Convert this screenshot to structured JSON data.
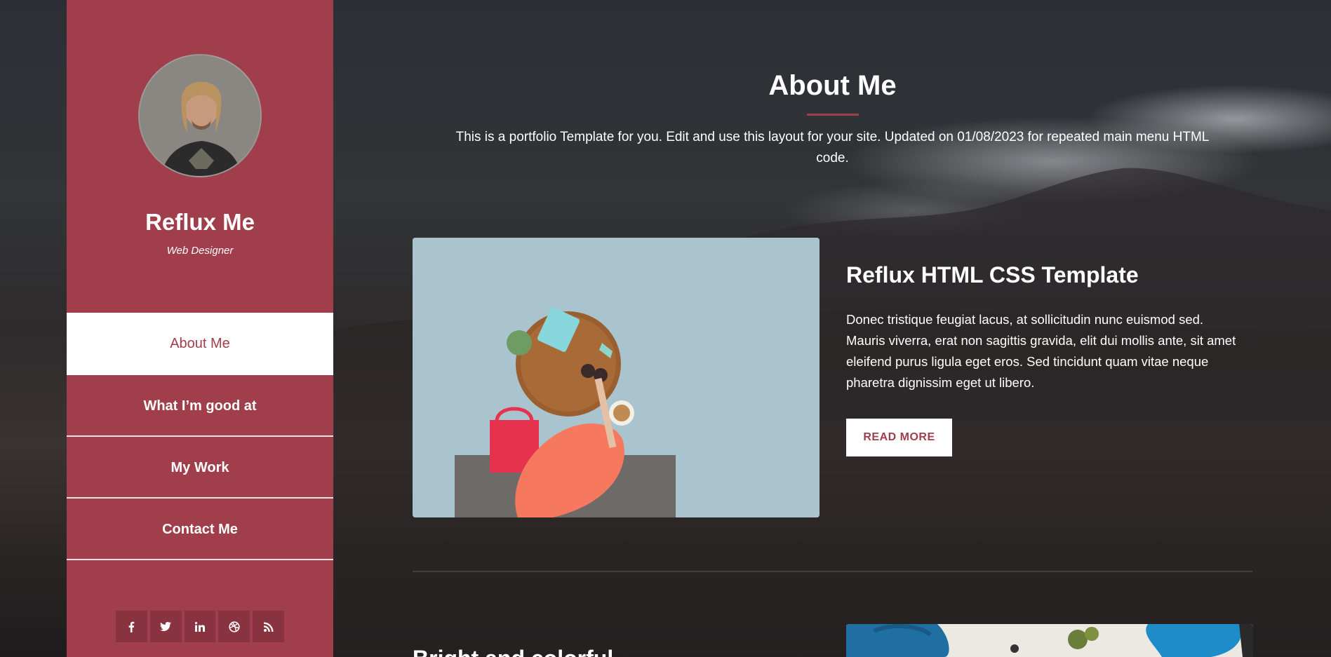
{
  "sidebar": {
    "profile_name": "Reflux Me",
    "profile_role": "Web Designer",
    "nav": [
      {
        "label": "About Me",
        "active": true
      },
      {
        "label": "What I’m good at",
        "active": false
      },
      {
        "label": "My Work",
        "active": false
      },
      {
        "label": "Contact Me",
        "active": false
      }
    ],
    "social": [
      "facebook-icon",
      "twitter-icon",
      "linkedin-icon",
      "dribbble-icon",
      "rss-icon"
    ]
  },
  "main": {
    "section_title": "About Me",
    "intro": "This is a portfolio Template for you. Edit and use this layout for your site. Updated on 01/08/2023 for repeated main menu HTML code.",
    "feature": {
      "title": "Reflux HTML CSS Template",
      "text": "Donec tristique feugiat lacus, at sollicitudin nunc euismod sed. Mauris viverra, erat non sagittis gravida, elit dui mollis ante, sit amet eleifend purus ligula eget eros. Sed tincidunt quam vitae neque pharetra dignissim eget ut libero.",
      "button_label": "READ MORE"
    },
    "second_feature": {
      "title": "Bright and colorful"
    }
  },
  "colors": {
    "accent": "#a13e4b",
    "social_button": "#8a3340",
    "background": "#262626"
  }
}
